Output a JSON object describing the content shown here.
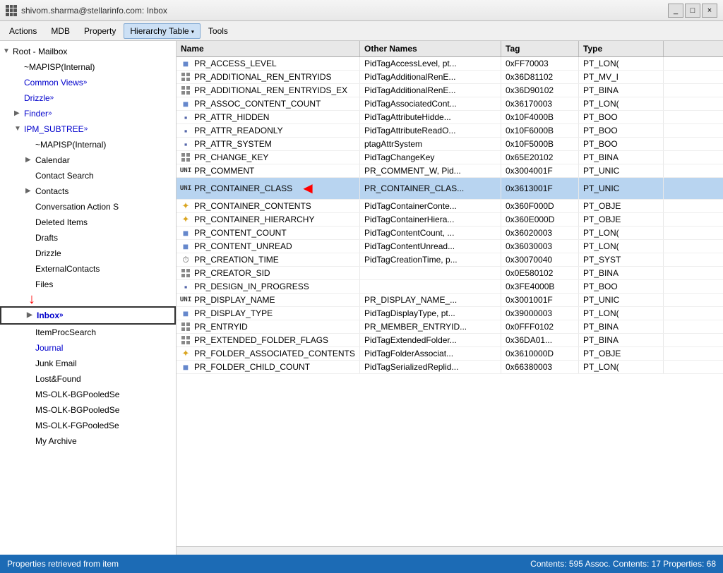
{
  "titlebar": {
    "title": "shivom.sharma@stellarinfo.com: Inbox",
    "controls": [
      "_",
      "□",
      "×"
    ]
  },
  "menubar": {
    "items": [
      {
        "id": "actions",
        "label": "Actions"
      },
      {
        "id": "mdb",
        "label": "MDB"
      },
      {
        "id": "property",
        "label": "Property"
      },
      {
        "id": "hierarchy-table",
        "label": "Hierarchy Table",
        "hasArrow": true
      },
      {
        "id": "tools",
        "label": "Tools"
      }
    ]
  },
  "tree": {
    "items": [
      {
        "id": "root",
        "label": "Root - Mailbox",
        "indent": 0,
        "expand": "▼",
        "expandable": true
      },
      {
        "id": "mapisp-internal",
        "label": "~MAPISP(Internal)",
        "indent": 1,
        "expand": ""
      },
      {
        "id": "common-views",
        "label": "Common Views",
        "indent": 1,
        "expand": "",
        "hasLinkIcon": true,
        "isBlue": true
      },
      {
        "id": "drizzle",
        "label": "Drizzle",
        "indent": 1,
        "expand": "",
        "hasLinkIcon": true,
        "isBlue": true
      },
      {
        "id": "finder",
        "label": "Finder",
        "indent": 1,
        "expand": "▶",
        "expandable": true,
        "hasLinkIcon": true,
        "isBlue": true
      },
      {
        "id": "ipm-subtree",
        "label": "IPM_SUBTREE",
        "indent": 1,
        "expand": "▼",
        "expandable": true,
        "hasLinkIcon": true,
        "isBlue": true
      },
      {
        "id": "mapisp2",
        "label": "~MAPISP(Internal)",
        "indent": 2,
        "expand": ""
      },
      {
        "id": "calendar",
        "label": "Calendar",
        "indent": 2,
        "expand": "▶",
        "expandable": true
      },
      {
        "id": "contact-search",
        "label": "Contact Search",
        "indent": 2,
        "expand": ""
      },
      {
        "id": "contacts",
        "label": "Contacts",
        "indent": 2,
        "expand": "▶",
        "expandable": true
      },
      {
        "id": "conversation-action",
        "label": "Conversation Action S",
        "indent": 2,
        "expand": ""
      },
      {
        "id": "deleted-items",
        "label": "Deleted Items",
        "indent": 2,
        "expand": ""
      },
      {
        "id": "drafts",
        "label": "Drafts",
        "indent": 2,
        "expand": ""
      },
      {
        "id": "drizzle2",
        "label": "Drizzle",
        "indent": 2,
        "expand": ""
      },
      {
        "id": "external-contacts",
        "label": "ExternalContacts",
        "indent": 2,
        "expand": ""
      },
      {
        "id": "files",
        "label": "Files",
        "indent": 2,
        "expand": ""
      },
      {
        "id": "inbox",
        "label": "Inbox",
        "indent": 2,
        "expand": "▶",
        "expandable": true,
        "selected": true,
        "hasLinkIcon": true,
        "isBlue": true,
        "hasArrowDown": false,
        "highlighted": true
      },
      {
        "id": "itemprocsearch",
        "label": "ItemProcSearch",
        "indent": 2,
        "expand": ""
      },
      {
        "id": "journal",
        "label": "Journal",
        "indent": 2,
        "expand": "",
        "isBlue": true
      },
      {
        "id": "junk-email",
        "label": "Junk Email",
        "indent": 2,
        "expand": ""
      },
      {
        "id": "lost-found",
        "label": "Lost&Found",
        "indent": 2,
        "expand": ""
      },
      {
        "id": "ms-olk-bgpooled1",
        "label": "MS-OLK-BGPooledSe",
        "indent": 2,
        "expand": ""
      },
      {
        "id": "ms-olk-bgpooled2",
        "label": "MS-OLK-BGPooledSe",
        "indent": 2,
        "expand": ""
      },
      {
        "id": "ms-olk-fgpooled",
        "label": "MS-OLK-FGPooledSe",
        "indent": 2,
        "expand": ""
      },
      {
        "id": "my-archive",
        "label": "My Archive",
        "indent": 2,
        "expand": ""
      }
    ]
  },
  "table": {
    "columns": [
      {
        "id": "name",
        "label": "Name"
      },
      {
        "id": "other-names",
        "label": "Other Names"
      },
      {
        "id": "tag",
        "label": "Tag"
      },
      {
        "id": "type",
        "label": "Type"
      }
    ],
    "rows": [
      {
        "icon": "square",
        "name": "PR_ACCESS_LEVEL",
        "other": "PidTagAccessLevel, pt...",
        "tag": "0xFF70003",
        "type": "PT_LON(",
        "selected": false
      },
      {
        "icon": "grid",
        "name": "PR_ADDITIONAL_REN_ENTRYIDS",
        "other": "PidTagAdditionalRenE...",
        "tag": "0x36D81102",
        "type": "PT_MV_I",
        "selected": false
      },
      {
        "icon": "grid",
        "name": "PR_ADDITIONAL_REN_ENTRYIDS_EX",
        "other": "PidTagAdditionalRenE...",
        "tag": "0x36D90102",
        "type": "PT_BINA",
        "selected": false
      },
      {
        "icon": "square",
        "name": "PR_ASSOC_CONTENT_COUNT",
        "other": "PidTagAssociatedCont...",
        "tag": "0x36170003",
        "type": "PT_LON(",
        "selected": false
      },
      {
        "icon": "square-sm",
        "name": "PR_ATTR_HIDDEN",
        "other": "PidTagAttributeHidde...",
        "tag": "0x10F4000B",
        "type": "PT_BOO",
        "selected": false
      },
      {
        "icon": "square-sm",
        "name": "PR_ATTR_READONLY",
        "other": "PidTagAttributeReadO...",
        "tag": "0x10F6000B",
        "type": "PT_BOO",
        "selected": false
      },
      {
        "icon": "square-sm",
        "name": "PR_ATTR_SYSTEM",
        "other": "ptagAttrSystem",
        "tag": "0x10F5000B",
        "type": "PT_BOO",
        "selected": false
      },
      {
        "icon": "grid",
        "name": "PR_CHANGE_KEY",
        "other": "PidTagChangeKey",
        "tag": "0x65E20102",
        "type": "PT_BINA",
        "selected": false
      },
      {
        "icon": "uni",
        "name": "PR_COMMENT",
        "other": "PR_COMMENT_W, Pid...",
        "tag": "0x3004001F",
        "type": "PT_UNIC",
        "selected": false
      },
      {
        "icon": "uni",
        "name": "PR_CONTAINER_CLASS",
        "other": "PR_CONTAINER_CLAS...",
        "tag": "0x3613001F",
        "type": "PT_UNIC",
        "selected": true,
        "hasArrow": true
      },
      {
        "icon": "star",
        "name": "PR_CONTAINER_CONTENTS",
        "other": "PidTagContainerConte...",
        "tag": "0x360F000D",
        "type": "PT_OBJE",
        "selected": false
      },
      {
        "icon": "star",
        "name": "PR_CONTAINER_HIERARCHY",
        "other": "PidTagContainerHiera...",
        "tag": "0x360E000D",
        "type": "PT_OBJE",
        "selected": false
      },
      {
        "icon": "square",
        "name": "PR_CONTENT_COUNT",
        "other": "PidTagContentCount, ...",
        "tag": "0x36020003",
        "type": "PT_LON(",
        "selected": false
      },
      {
        "icon": "square",
        "name": "PR_CONTENT_UNREAD",
        "other": "PidTagContentUnread...",
        "tag": "0x36030003",
        "type": "PT_LON(",
        "selected": false
      },
      {
        "icon": "clock",
        "name": "PR_CREATION_TIME",
        "other": "PidTagCreationTime, p...",
        "tag": "0x30070040",
        "type": "PT_SYST",
        "selected": false
      },
      {
        "icon": "grid",
        "name": "PR_CREATOR_SID",
        "other": "",
        "tag": "0x0E580102",
        "type": "PT_BINA",
        "selected": false
      },
      {
        "icon": "square-sm",
        "name": "PR_DESIGN_IN_PROGRESS",
        "other": "",
        "tag": "0x3FE4000B",
        "type": "PT_BOO",
        "selected": false
      },
      {
        "icon": "uni",
        "name": "PR_DISPLAY_NAME",
        "other": "PR_DISPLAY_NAME_...",
        "tag": "0x3001001F",
        "type": "PT_UNIC",
        "selected": false
      },
      {
        "icon": "square",
        "name": "PR_DISPLAY_TYPE",
        "other": "PidTagDisplayType, pt...",
        "tag": "0x39000003",
        "type": "PT_LON(",
        "selected": false
      },
      {
        "icon": "grid",
        "name": "PR_ENTRYID",
        "other": "PR_MEMBER_ENTRYID...",
        "tag": "0x0FFF0102",
        "type": "PT_BINA",
        "selected": false
      },
      {
        "icon": "grid",
        "name": "PR_EXTENDED_FOLDER_FLAGS",
        "other": "PidTagExtendedFolder...",
        "tag": "0x36DA01...",
        "type": "PT_BINA",
        "selected": false
      },
      {
        "icon": "star",
        "name": "PR_FOLDER_ASSOCIATED_CONTENTS",
        "other": "PidTagFolderAssociat...",
        "tag": "0x3610000D",
        "type": "PT_OBJE",
        "selected": false
      },
      {
        "icon": "square",
        "name": "PR_FOLDER_CHILD_COUNT",
        "other": "PidTagSerializedReplid...",
        "tag": "0x66380003",
        "type": "PT_LON(",
        "selected": false
      }
    ]
  },
  "statusbar": {
    "left": "Properties retrieved from item",
    "right": "Contents: 595  Assoc. Contents: 17  Properties: 68"
  }
}
